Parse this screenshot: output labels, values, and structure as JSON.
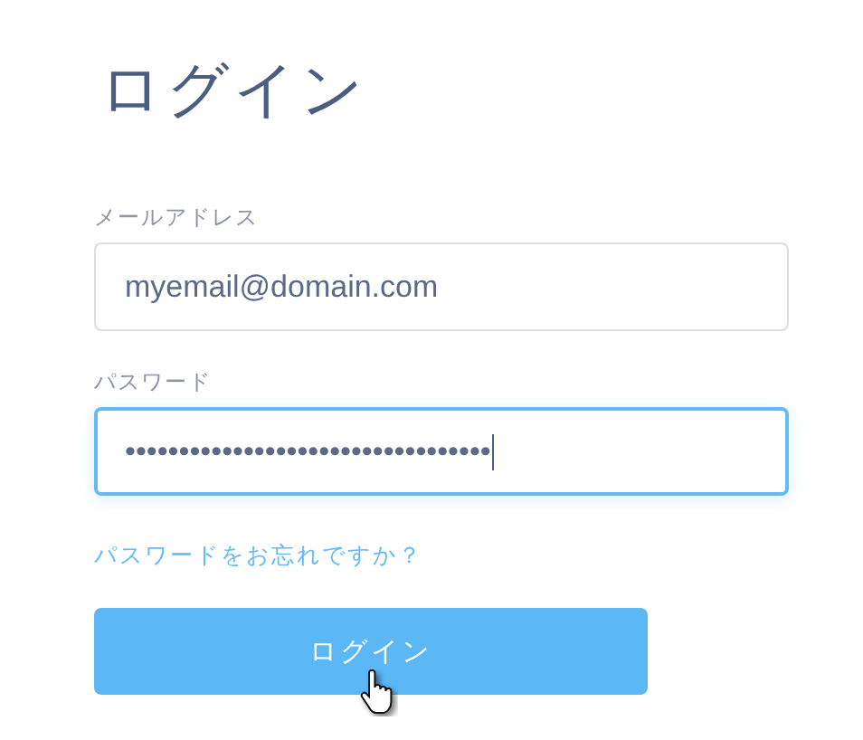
{
  "title": "ログイン",
  "fields": [
    {
      "label": "メールアドレス",
      "value": "myemail@domain.com",
      "focused": false
    },
    {
      "label": "パスワード",
      "value": "••••••••••••••••••••••••••••••••••",
      "focused": true
    }
  ],
  "forgot_link": "パスワードをお忘れですか？",
  "submit_button": "ログイン"
}
